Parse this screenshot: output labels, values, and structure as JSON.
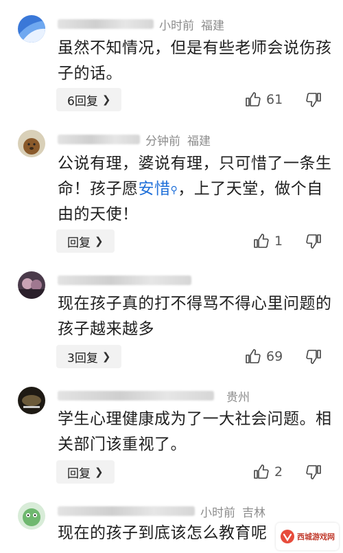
{
  "comments": [
    {
      "time": "小时前",
      "region": "福建",
      "text": "虽然不知情况，但是有些老师会说伤孩子的话。",
      "reply_label": "6回复",
      "likes": "61"
    },
    {
      "time": "分钟前",
      "region": "福建",
      "text_before": "公说有理，婆说有理，只可惜了一条生命！孩子愿",
      "link_text": "安惜",
      "text_after": "，上了天堂，做个自由的天使！",
      "reply_label": "回复",
      "likes": "1"
    },
    {
      "time": "",
      "region": "",
      "text": "现在孩子真的打不得骂不得心里问题的孩子越来越多",
      "reply_label": "3回复",
      "likes": "69"
    },
    {
      "time": "",
      "region": "贵州",
      "text": "学生心理健康成为了一大社会问题。相关部门该重视了。",
      "reply_label": "回复",
      "likes": "2"
    },
    {
      "time": "小时前",
      "region": "吉林",
      "text": "现在的孩子到底该怎么教育呢",
      "reply_label": "",
      "likes": ""
    }
  ],
  "watermark": {
    "text": "西城游戏网"
  },
  "colors": {
    "link": "#1e6fd9",
    "meta": "#8c8c8c",
    "reply_bg": "#f2f2f2"
  },
  "icons": [
    "thumbs-up-icon",
    "thumbs-down-icon",
    "chevron-right-icon",
    "search-mark-icon"
  ]
}
